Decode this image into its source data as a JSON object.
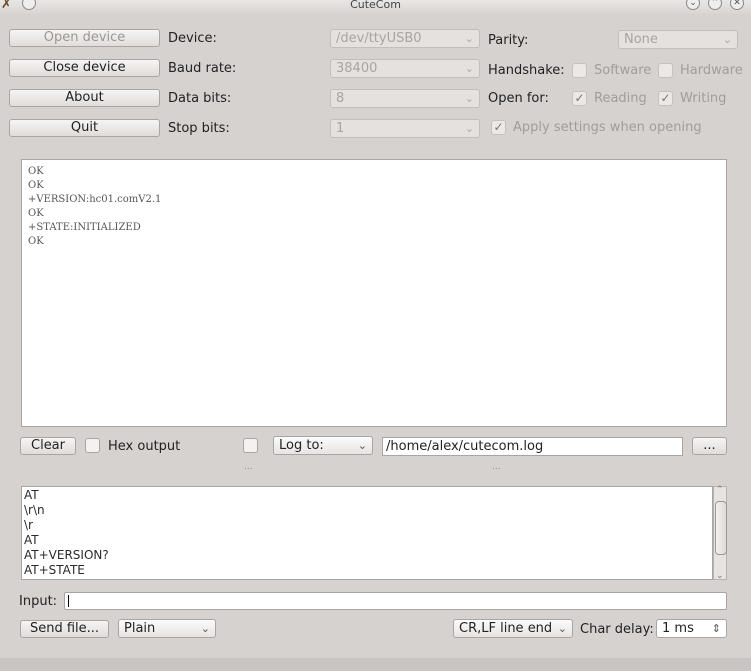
{
  "window": {
    "title": "CuteCom"
  },
  "buttons": {
    "open_device": "Open device",
    "close_device": "Close device",
    "about": "About",
    "quit": "Quit",
    "clear": "Clear",
    "browse": "...",
    "send_file": "Send file..."
  },
  "settings": {
    "device": {
      "label": "Device:",
      "value": "/dev/ttyUSB0"
    },
    "baud_rate": {
      "label": "Baud rate:",
      "value": "38400"
    },
    "data_bits": {
      "label": "Data bits:",
      "value": "8"
    },
    "stop_bits": {
      "label": "Stop bits:",
      "value": "1"
    },
    "parity": {
      "label": "Parity:",
      "value": "None"
    },
    "handshake": {
      "label": "Handshake:",
      "software": "Software",
      "hardware": "Hardware"
    },
    "open_for": {
      "label": "Open for:",
      "reading": "Reading",
      "writing": "Writing"
    },
    "apply_settings": "Apply settings when opening"
  },
  "output_lines": [
    "OK",
    "OK",
    "+VERSION:hc01.comV2.1",
    "OK",
    "+STATE:INITIALIZED",
    "OK"
  ],
  "controls": {
    "hex_output": "Hex output",
    "log_to": "Log to:",
    "log_path": "/home/alex/cutecom.log",
    "splitter_dots": "..."
  },
  "history": [
    "AT",
    "\\r\\n",
    "\\r",
    "AT",
    "AT+VERSION?",
    "AT+STATE"
  ],
  "input": {
    "label": "Input:",
    "value": ""
  },
  "bottom": {
    "format": "Plain",
    "line_end": "CR,LF line end",
    "char_delay_label": "Char delay:",
    "char_delay": "1 ms"
  }
}
